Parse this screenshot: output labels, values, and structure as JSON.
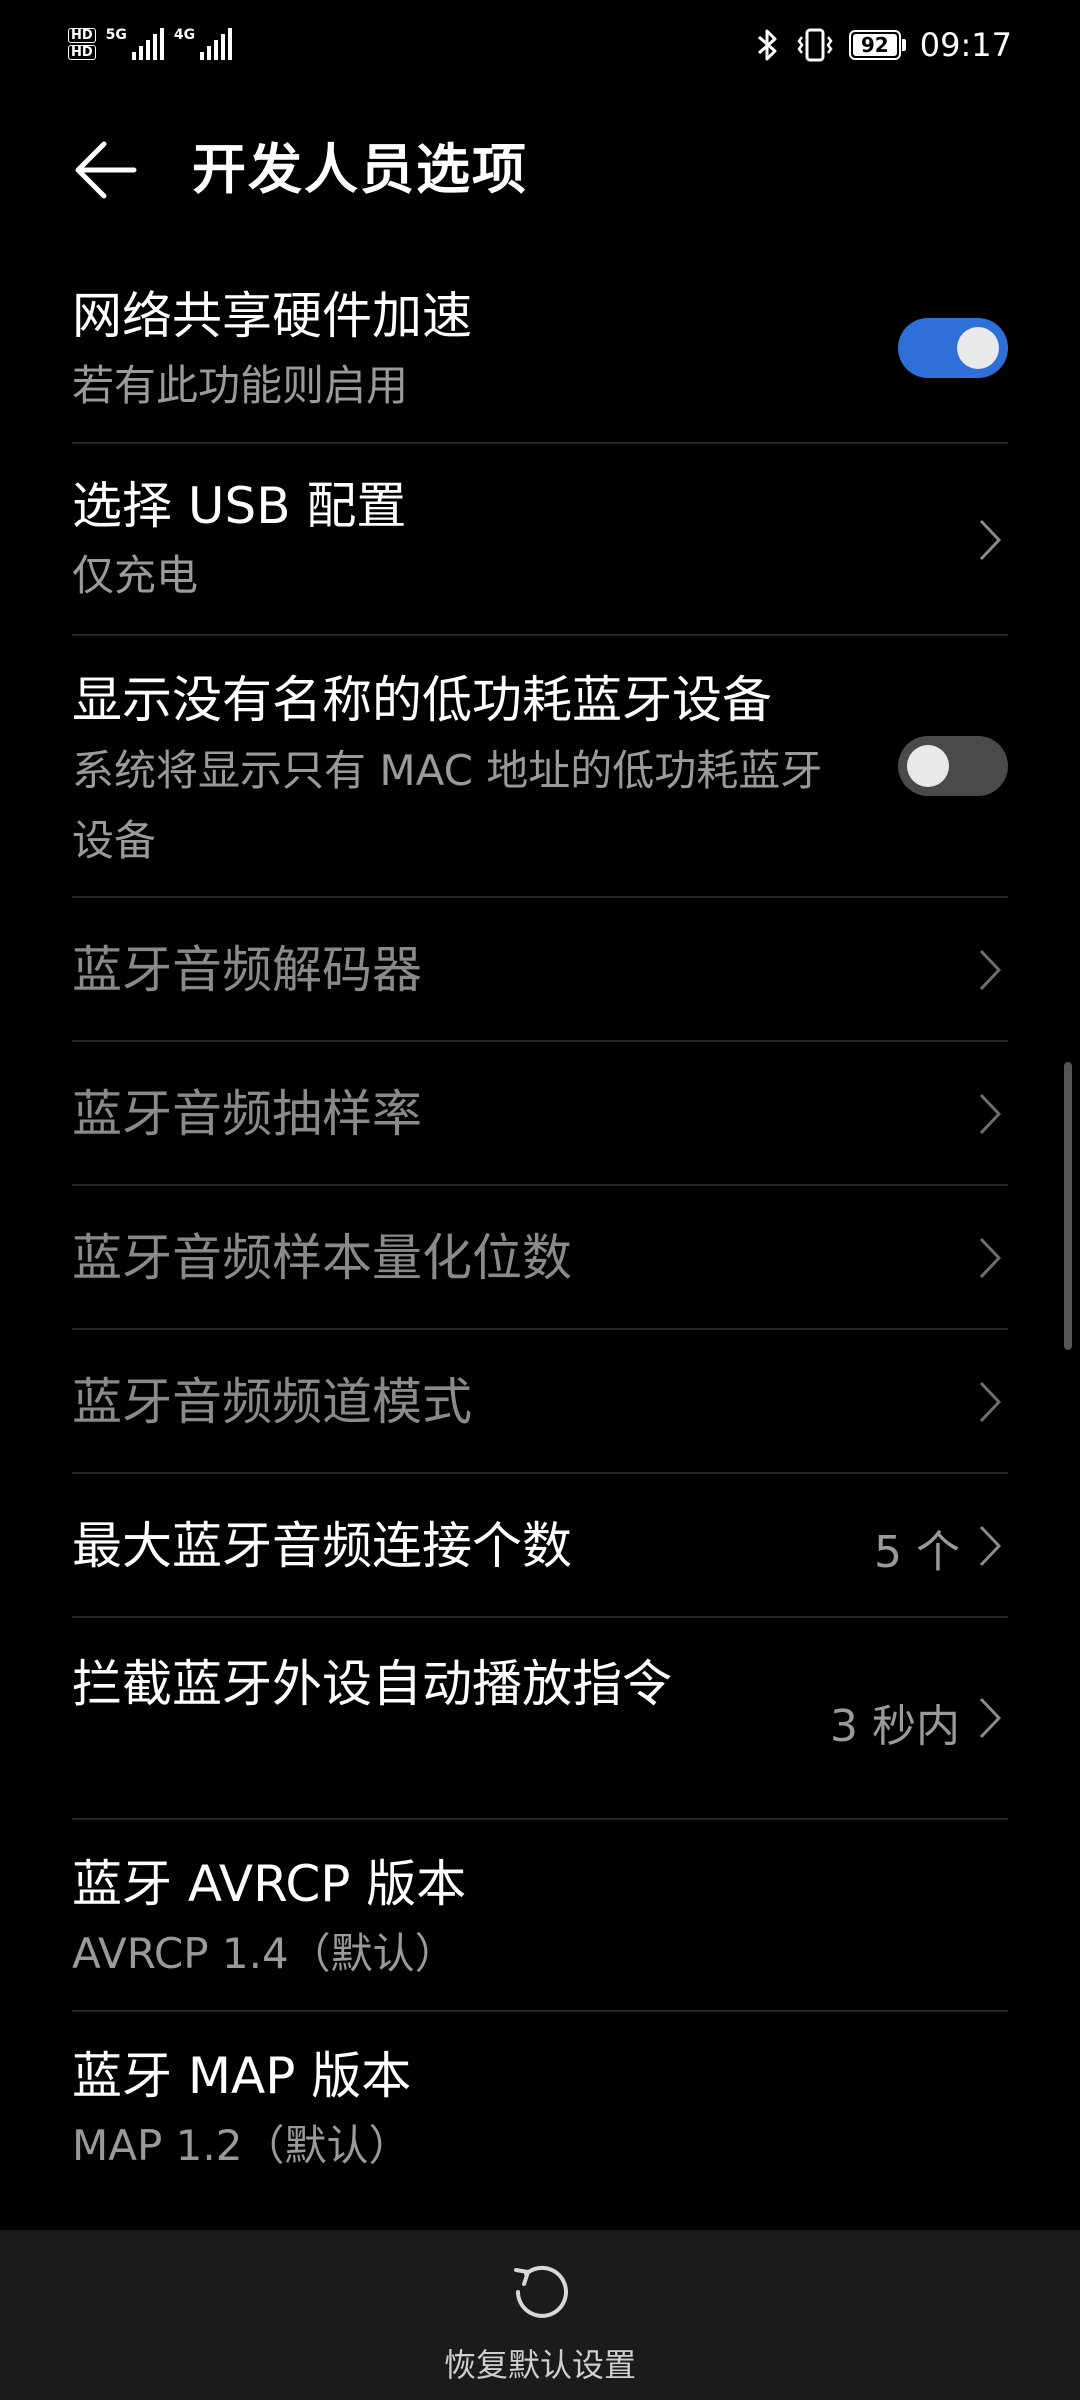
{
  "status_bar": {
    "network_left": "5G",
    "network_right": "4G",
    "battery": "92",
    "time": "09:17"
  },
  "header": {
    "title": "开发人员选项"
  },
  "settings": [
    {
      "title": "网络共享硬件加速",
      "subtitle": "若有此功能则启用",
      "control": "toggle",
      "state": "on"
    },
    {
      "title": "选择 USB 配置",
      "subtitle": "仅充电",
      "control": "chevron"
    },
    {
      "title": "显示没有名称的低功耗蓝牙设备",
      "subtitle": "系统将显示只有 MAC 地址的低功耗蓝牙设备",
      "control": "toggle",
      "state": "off"
    },
    {
      "title": "蓝牙音频解码器",
      "control": "chevron",
      "disabled": true
    },
    {
      "title": "蓝牙音频抽样率",
      "control": "chevron",
      "disabled": true
    },
    {
      "title": "蓝牙音频样本量化位数",
      "control": "chevron",
      "disabled": true
    },
    {
      "title": "蓝牙音频频道模式",
      "control": "chevron",
      "disabled": true
    },
    {
      "title": "最大蓝牙音频连接个数",
      "value": "5 个",
      "control": "chevron"
    },
    {
      "title": "拦截蓝牙外设自动播放指令",
      "value": "3 秒内",
      "control": "chevron"
    },
    {
      "title": "蓝牙 AVRCP 版本",
      "subtitle": "AVRCP 1.4（默认）"
    },
    {
      "title": "蓝牙 MAP 版本",
      "subtitle": "MAP 1.2（默认）"
    }
  ],
  "bottom": {
    "restore_label": "恢复默认设置"
  },
  "colors": {
    "toggle_on": "#2f6fd8",
    "toggle_off": "#4a4a4a",
    "background": "#000000"
  }
}
